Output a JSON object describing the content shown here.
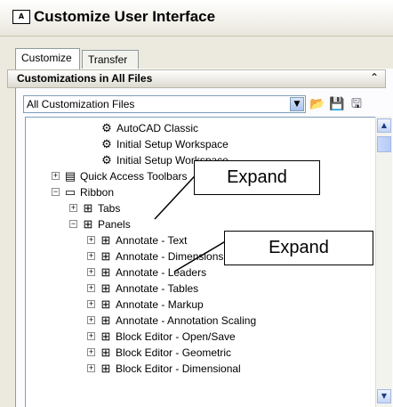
{
  "window": {
    "title": "Customize User Interface",
    "app_icon_text": "A"
  },
  "tabs": [
    {
      "label": "Customize"
    },
    {
      "label": "Transfer"
    }
  ],
  "section": {
    "title": "Customizations in All Files"
  },
  "selector": {
    "value": "All Customization Files"
  },
  "icons": {
    "collapse": "double-chevron-up-icon",
    "dropdown": "chevron-down-icon",
    "open": "open-folder-icon",
    "save": "save-disk-icon",
    "saveas": "save-as-icon",
    "workspace_item": "gear-icon",
    "toolbar": "toolbar-icon",
    "ribbon": "ribbon-icon",
    "panel": "panel-icon"
  },
  "tree": [
    {
      "label": "AutoCAD Classic"
    },
    {
      "label": "Initial Setup Workspace"
    },
    {
      "label": "Initial Setup Workspace"
    },
    {
      "label": "Quick Access Toolbars"
    },
    {
      "label": "Ribbon"
    },
    {
      "label": "Tabs"
    },
    {
      "label": "Panels"
    },
    {
      "label": "Annotate - Text"
    },
    {
      "label": "Annotate - Dimensions"
    },
    {
      "label": "Annotate - Leaders"
    },
    {
      "label": "Annotate - Tables"
    },
    {
      "label": "Annotate - Markup"
    },
    {
      "label": "Annotate - Annotation Scaling"
    },
    {
      "label": "Block Editor - Open/Save"
    },
    {
      "label": "Block Editor - Geometric"
    },
    {
      "label": "Block Editor - Dimensional"
    }
  ],
  "callouts": [
    {
      "text": "Expand"
    },
    {
      "text": "Expand"
    }
  ]
}
